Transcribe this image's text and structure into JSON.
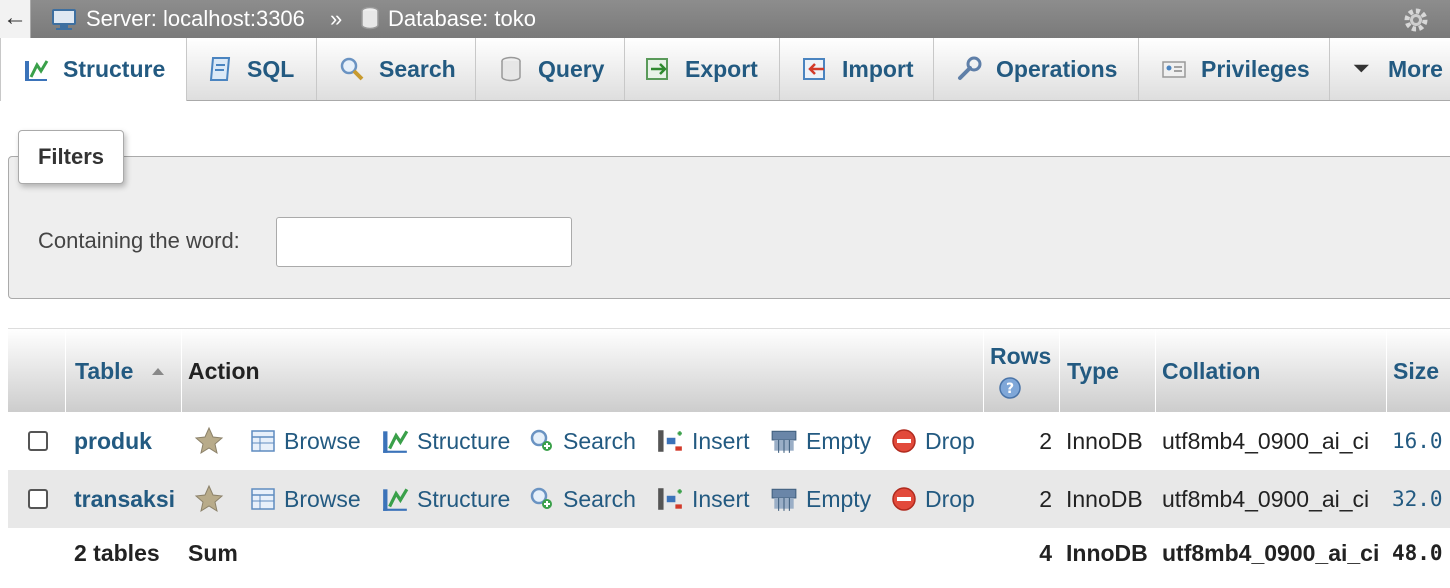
{
  "breadcrumb": {
    "back": "←",
    "server": "Server: localhost:3306",
    "separator": "»",
    "database": "Database: toko"
  },
  "tabs": [
    {
      "label": "Structure",
      "icon": "structure-icon"
    },
    {
      "label": "SQL",
      "icon": "sql-icon"
    },
    {
      "label": "Search",
      "icon": "search-icon"
    },
    {
      "label": "Query",
      "icon": "query-icon"
    },
    {
      "label": "Export",
      "icon": "export-icon"
    },
    {
      "label": "Import",
      "icon": "import-icon"
    },
    {
      "label": "Operations",
      "icon": "wrench-icon"
    },
    {
      "label": "Privileges",
      "icon": "privileges-icon"
    },
    {
      "label": "More",
      "icon": "dropdown-triangle-icon"
    }
  ],
  "filters": {
    "legend": "Filters",
    "label": "Containing the word:",
    "value": ""
  },
  "table": {
    "headers": {
      "table": "Table",
      "action": "Action",
      "rows": "Rows",
      "type": "Type",
      "collation": "Collation",
      "size": "Size"
    },
    "actions": [
      "Browse",
      "Structure",
      "Search",
      "Insert",
      "Empty",
      "Drop"
    ],
    "rows": [
      {
        "name": "produk",
        "rows": "2",
        "type": "InnoDB",
        "collation": "utf8mb4_0900_ai_ci",
        "size": "16.0"
      },
      {
        "name": "transaksi",
        "rows": "2",
        "type": "InnoDB",
        "collation": "utf8mb4_0900_ai_ci",
        "size": "32.0"
      }
    ],
    "summary": {
      "count": "2 tables",
      "label": "Sum",
      "rows": "4",
      "type": "InnoDB",
      "collation": "utf8mb4_0900_ai_ci",
      "size": "48.0"
    }
  },
  "colors": {
    "link": "#235a81",
    "topbar": "#858585",
    "filter_bg": "#eeeeee"
  }
}
